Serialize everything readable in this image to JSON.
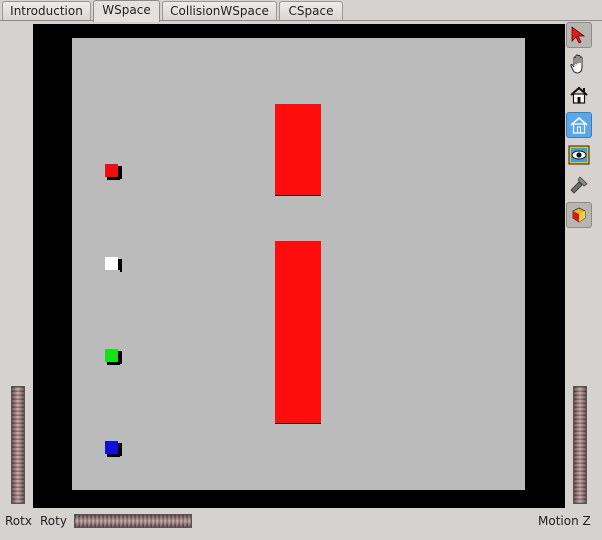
{
  "tabs": [
    {
      "label": "Introduction",
      "active": false
    },
    {
      "label": "WSpace",
      "active": true
    },
    {
      "label": "CollisionWSpace",
      "active": false
    },
    {
      "label": "CSpace",
      "active": false
    }
  ],
  "scene": {
    "background_color": "#000000",
    "workspace_color": "#bbbbbb",
    "obstacles": [
      {
        "name": "upper-obstacle",
        "color": "#ff0d0d"
      },
      {
        "name": "lower-obstacle",
        "color": "#ff0d0d"
      }
    ],
    "robots": [
      {
        "name": "red-robot",
        "color": "#ee1010"
      },
      {
        "name": "white-robot",
        "color": "#ffffff"
      },
      {
        "name": "green-robot",
        "color": "#18e018"
      },
      {
        "name": "blue-robot",
        "color": "#1010d8"
      }
    ]
  },
  "toolbar": {
    "tools": [
      {
        "name": "select-arrow-icon",
        "state": "selected"
      },
      {
        "name": "hand-icon",
        "state": "normal"
      },
      {
        "name": "home-icon",
        "state": "normal"
      },
      {
        "name": "set-home-icon",
        "state": "pressed"
      },
      {
        "name": "view-all-icon",
        "state": "normal"
      },
      {
        "name": "seek-flashlight-icon",
        "state": "normal"
      },
      {
        "name": "projection-icon",
        "state": "selected"
      }
    ]
  },
  "controls": {
    "rotx_label": "Rotx",
    "roty_label": "Roty",
    "motion_z_label": "Motion Z"
  }
}
